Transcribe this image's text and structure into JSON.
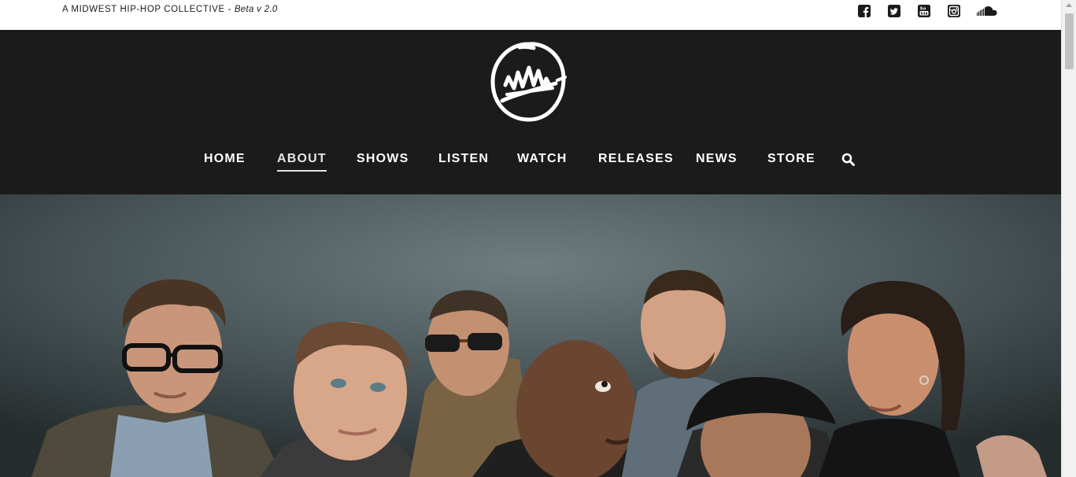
{
  "topbar": {
    "tagline": "A MIDWEST HIP-HOP COLLECTIVE - ",
    "beta": "Beta v 2.0",
    "social_icons": [
      "facebook-icon",
      "twitter-icon",
      "youtube-icon",
      "instagram-icon",
      "soundcloud-icon"
    ]
  },
  "nav": {
    "items": [
      {
        "label": "HOME"
      },
      {
        "label": "ABOUT",
        "active": true
      },
      {
        "label": "SHOWS"
      },
      {
        "label": "LISTEN"
      },
      {
        "label": "WATCH"
      },
      {
        "label": "RELEASES"
      },
      {
        "label": "NEWS"
      },
      {
        "label": "STORE"
      }
    ],
    "search_icon": "search-icon"
  },
  "colors": {
    "header_bg": "#1b1b1b",
    "nav_text": "#ffffff",
    "topbar_bg": "#ffffff"
  }
}
